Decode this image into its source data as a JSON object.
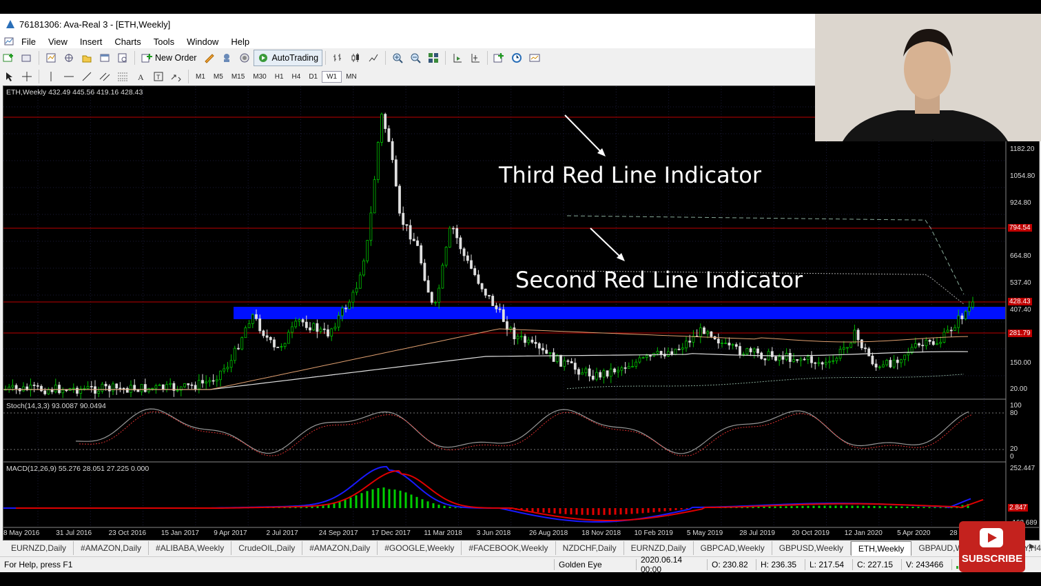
{
  "window": {
    "title": "76181306: Ava-Real 3 - [ETH,Weekly]"
  },
  "menu": [
    "File",
    "View",
    "Insert",
    "Charts",
    "Tools",
    "Window",
    "Help"
  ],
  "toolbar": {
    "new_order": "New Order",
    "autotrading": "AutoTrading"
  },
  "timeframes": [
    "M1",
    "M5",
    "M15",
    "M30",
    "H1",
    "H4",
    "D1",
    "W1",
    "MN"
  ],
  "active_timeframe": "W1",
  "chart": {
    "header": "ETH,Weekly  432.49 445.56 419.16 428.43",
    "price_axis": [
      "1182.20",
      "1054.80",
      "924.80",
      "794.54",
      "664.80",
      "537.40",
      "428.43",
      "407.40",
      "281.79",
      "150.00",
      "20.00"
    ],
    "highlight_prices": {
      "line_top": "794.54",
      "line_current": "428.43",
      "line_bottom": "281.79"
    },
    "stoch_label": "Stoch(14,3,3) 93.0087 90.0494",
    "stoch_levels": [
      "100",
      "80",
      "20",
      "0"
    ],
    "macd_label": "MACD(12,26,9) 55.276 28.051 27.225 0.000",
    "macd_levels": [
      "252.447",
      "2.847",
      "-162.689"
    ],
    "dates": [
      "8 May 2016",
      "31 Jul 2016",
      "23 Oct 2016",
      "15 Jan 2017",
      "9 Apr 2017",
      "2 Jul 2017",
      "24 Sep 2017",
      "17 Dec 2017",
      "11 Mar 2018",
      "3 Jun 2018",
      "26 Aug 2018",
      "18 Nov 2018",
      "10 Feb 2019",
      "5 May 2019",
      "28 Jul 2019",
      "20 Oct 2019",
      "12 Jan 2020",
      "5 Apr 2020",
      "28 Jun 2020"
    ],
    "annotation_third": "Third Red Line Indicator",
    "annotation_second": "Second Red Line Indicator",
    "colors": {
      "red_line": "#c00000",
      "blue_zone": "#0010ff",
      "candle_up": "#00c000",
      "macd": "#1a1aff",
      "signal": "#e00000"
    }
  },
  "tabs": [
    "EURNZD,Daily",
    "#AMAZON,Daily",
    "#ALIBABA,Weekly",
    "CrudeOIL,Daily",
    "#AMAZON,Daily",
    "#GOOGLE,Weekly",
    "#FACEBOOK,Weekly",
    "NZDCHF,Daily",
    "EURNZD,Daily",
    "GBPCAD,Weekly",
    "GBPUSD,Weekly",
    "ETH,Weekly",
    "GBPAUD,Weekly",
    "GBPJPY,H4"
  ],
  "active_tab": "ETH,Weekly",
  "status": {
    "help": "For Help, press F1",
    "profile": "Golden Eye",
    "time": "2020.06.14 00:00",
    "open": "O: 230.82",
    "high": "H: 236.35",
    "low": "L: 217.54",
    "close": "C: 227.15",
    "volume": "V: 243466"
  },
  "subscribe": "SUBSCRIBE"
}
